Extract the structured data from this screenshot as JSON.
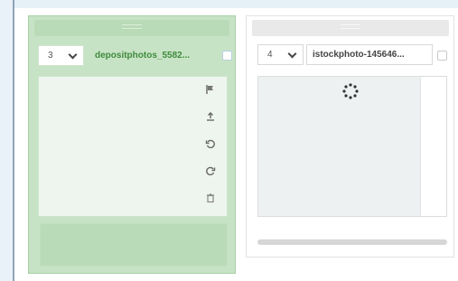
{
  "cards": [
    {
      "select_value": "3",
      "filename": "depositphotos_5582...",
      "toolbar_icons": [
        "flag-icon",
        "upload-icon",
        "rotate-left-icon",
        "rotate-right-icon",
        "trash-icon"
      ]
    },
    {
      "select_value": "4",
      "filename": "istockphoto-145646...",
      "status": "loading"
    }
  ],
  "colors": {
    "selected_bg": "#c7e3c5",
    "accent_green": "#3f8b3d"
  }
}
